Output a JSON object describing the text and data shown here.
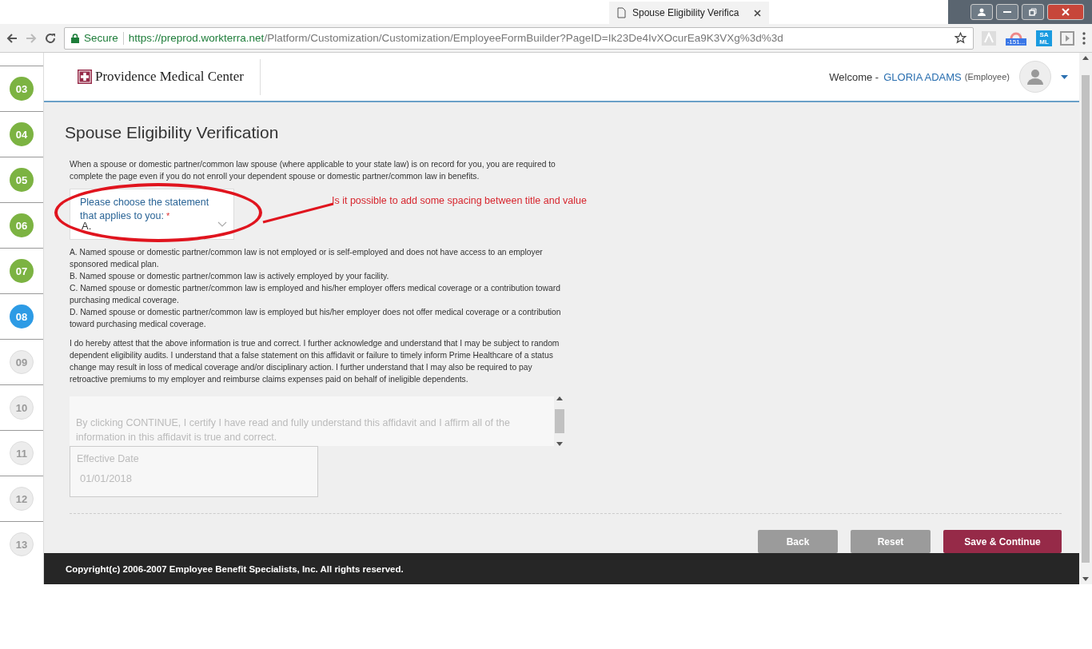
{
  "browser": {
    "tab_title": "Spouse Eligibility Verifica",
    "address": {
      "secure_label": "Secure",
      "url_host": "https://preprod.workterra.net",
      "url_path": "/Platform/Customization/Customization/EmployeeFormBuilder?PageID=Ik23De4IvXOcurEa9K3VXg%3d%3d"
    },
    "extension_badge": "-151...",
    "extension_label": "SAML"
  },
  "header": {
    "logo_text": "Providence Medical Center",
    "welcome": "Welcome -",
    "user_name": "GLORIA ADAMS",
    "role": "(Employee)"
  },
  "steps": [
    {
      "label": "03",
      "kind": "done"
    },
    {
      "label": "04",
      "kind": "done"
    },
    {
      "label": "05",
      "kind": "done"
    },
    {
      "label": "06",
      "kind": "done"
    },
    {
      "label": "07",
      "kind": "done"
    },
    {
      "label": "08",
      "kind": "current"
    },
    {
      "label": "09",
      "kind": "pending"
    },
    {
      "label": "10",
      "kind": "pending"
    },
    {
      "label": "11",
      "kind": "pending"
    },
    {
      "label": "12",
      "kind": "pending"
    },
    {
      "label": "13",
      "kind": "pending"
    }
  ],
  "form": {
    "title": "Spouse Eligibility Verification",
    "intro": "When a spouse or domestic partner/common law spouse (where applicable to your state law) is on record for you, you are required to complete the page even if you do not enroll your dependent spouse or domestic partner/common law in benefits.",
    "select": {
      "label": "Please choose the statement that applies to you:",
      "required_mark": "*",
      "value": "A."
    },
    "options": [
      "A. Named spouse or domestic partner/common law is not employed or is self-employed and does not have access to an employer sponsored medical plan.",
      "B. Named spouse or domestic partner/common law is actively employed by your facility.",
      "C. Named spouse or domestic partner/common law is employed and his/her employer offers medical coverage or a contribution toward purchasing medical coverage.",
      "D. Named spouse or domestic partner/common law is employed but his/her employer does not offer medical coverage or a contribution toward purchasing medical coverage."
    ],
    "attestation": "I do hereby attest that the above information is true and correct. I further acknowledge and understand that I may be subject to random dependent eligibility audits. I understand that a false statement on this affidavit or failure to timely inform Prime Healthcare of a status change may result in loss of medical coverage and/or disciplinary action. I further understand that I may also be required to pay retroactive premiums to my employer and reimburse claims expenses paid on behalf of ineligible dependents.",
    "affidavit": {
      "text": "By clicking CONTINUE, I certify I have read and fully understand this affidavit and I affirm all of the information in this affidavit is true and correct.",
      "disabled": true
    },
    "effective_date": {
      "label": "Effective Date",
      "value": "01/01/2018",
      "disabled": true
    },
    "buttons": [
      {
        "label": "Back",
        "kind": "secondary"
      },
      {
        "label": "Reset",
        "kind": "secondary"
      },
      {
        "label": "Save & Continue",
        "kind": "primary"
      }
    ]
  },
  "annotation": {
    "text": "Is it possible to add some spacing between title and value"
  },
  "footer": {
    "copyright": "Copyright(c) 2006-2007 Employee Benefit Specialists, Inc. All rights reserved."
  }
}
